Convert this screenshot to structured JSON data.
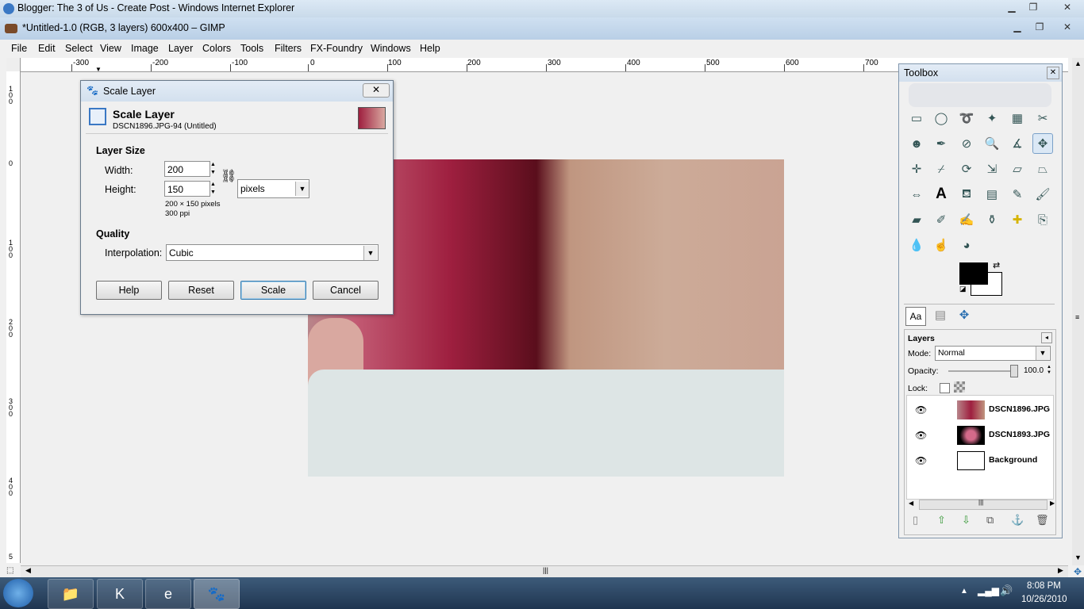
{
  "ie_window": {
    "title": "Blogger: The 3 of Us - Create Post - Windows Internet Explorer"
  },
  "gimp_window": {
    "title": "*Untitled-1.0 (RGB, 3 layers) 600x400 – GIMP"
  },
  "menu": [
    "File",
    "Edit",
    "Select",
    "View",
    "Image",
    "Layer",
    "Colors",
    "Tools",
    "Filters",
    "FX-Foundry",
    "Windows",
    "Help"
  ],
  "ruler_h": [
    "-300",
    "-200",
    "-100",
    "0",
    "100",
    "200",
    "300",
    "400",
    "500",
    "600",
    "700"
  ],
  "ruler_v": [
    "1\n0\n0",
    "0",
    "1\n0\n0",
    "2\n0\n0",
    "3\n0\n0",
    "4\n0\n0",
    "5"
  ],
  "dialog": {
    "window_title": "Scale Layer",
    "heading": "Scale Layer",
    "subheading": "DSCN1896.JPG-94 (Untitled)",
    "layer_size_label": "Layer Size",
    "width_label": "Width:",
    "width_value": "200",
    "height_label": "Height:",
    "height_value": "150",
    "unit": "pixels",
    "size_info": "200 × 150 pixels",
    "ppi_info": "300 ppi",
    "quality_label": "Quality",
    "interpolation_label": "Interpolation:",
    "interpolation_value": "Cubic",
    "buttons": {
      "help": "Help",
      "reset": "Reset",
      "scale": "Scale",
      "cancel": "Cancel"
    }
  },
  "toolbox": {
    "title": "Toolbox",
    "layers_title": "Layers",
    "mode_label": "Mode:",
    "mode_value": "Normal",
    "opacity_label": "Opacity:",
    "opacity_value": "100.0",
    "lock_label": "Lock:",
    "layers": [
      {
        "name": "DSCN1896.JPG"
      },
      {
        "name": "DSCN1893.JPG"
      },
      {
        "name": "Background"
      }
    ]
  },
  "taskbar": {
    "time": "8:08 PM",
    "date": "10/26/2010"
  },
  "colors": {
    "fg": "#000000",
    "bg": "#ffffff",
    "accent": "#3a78c4"
  }
}
